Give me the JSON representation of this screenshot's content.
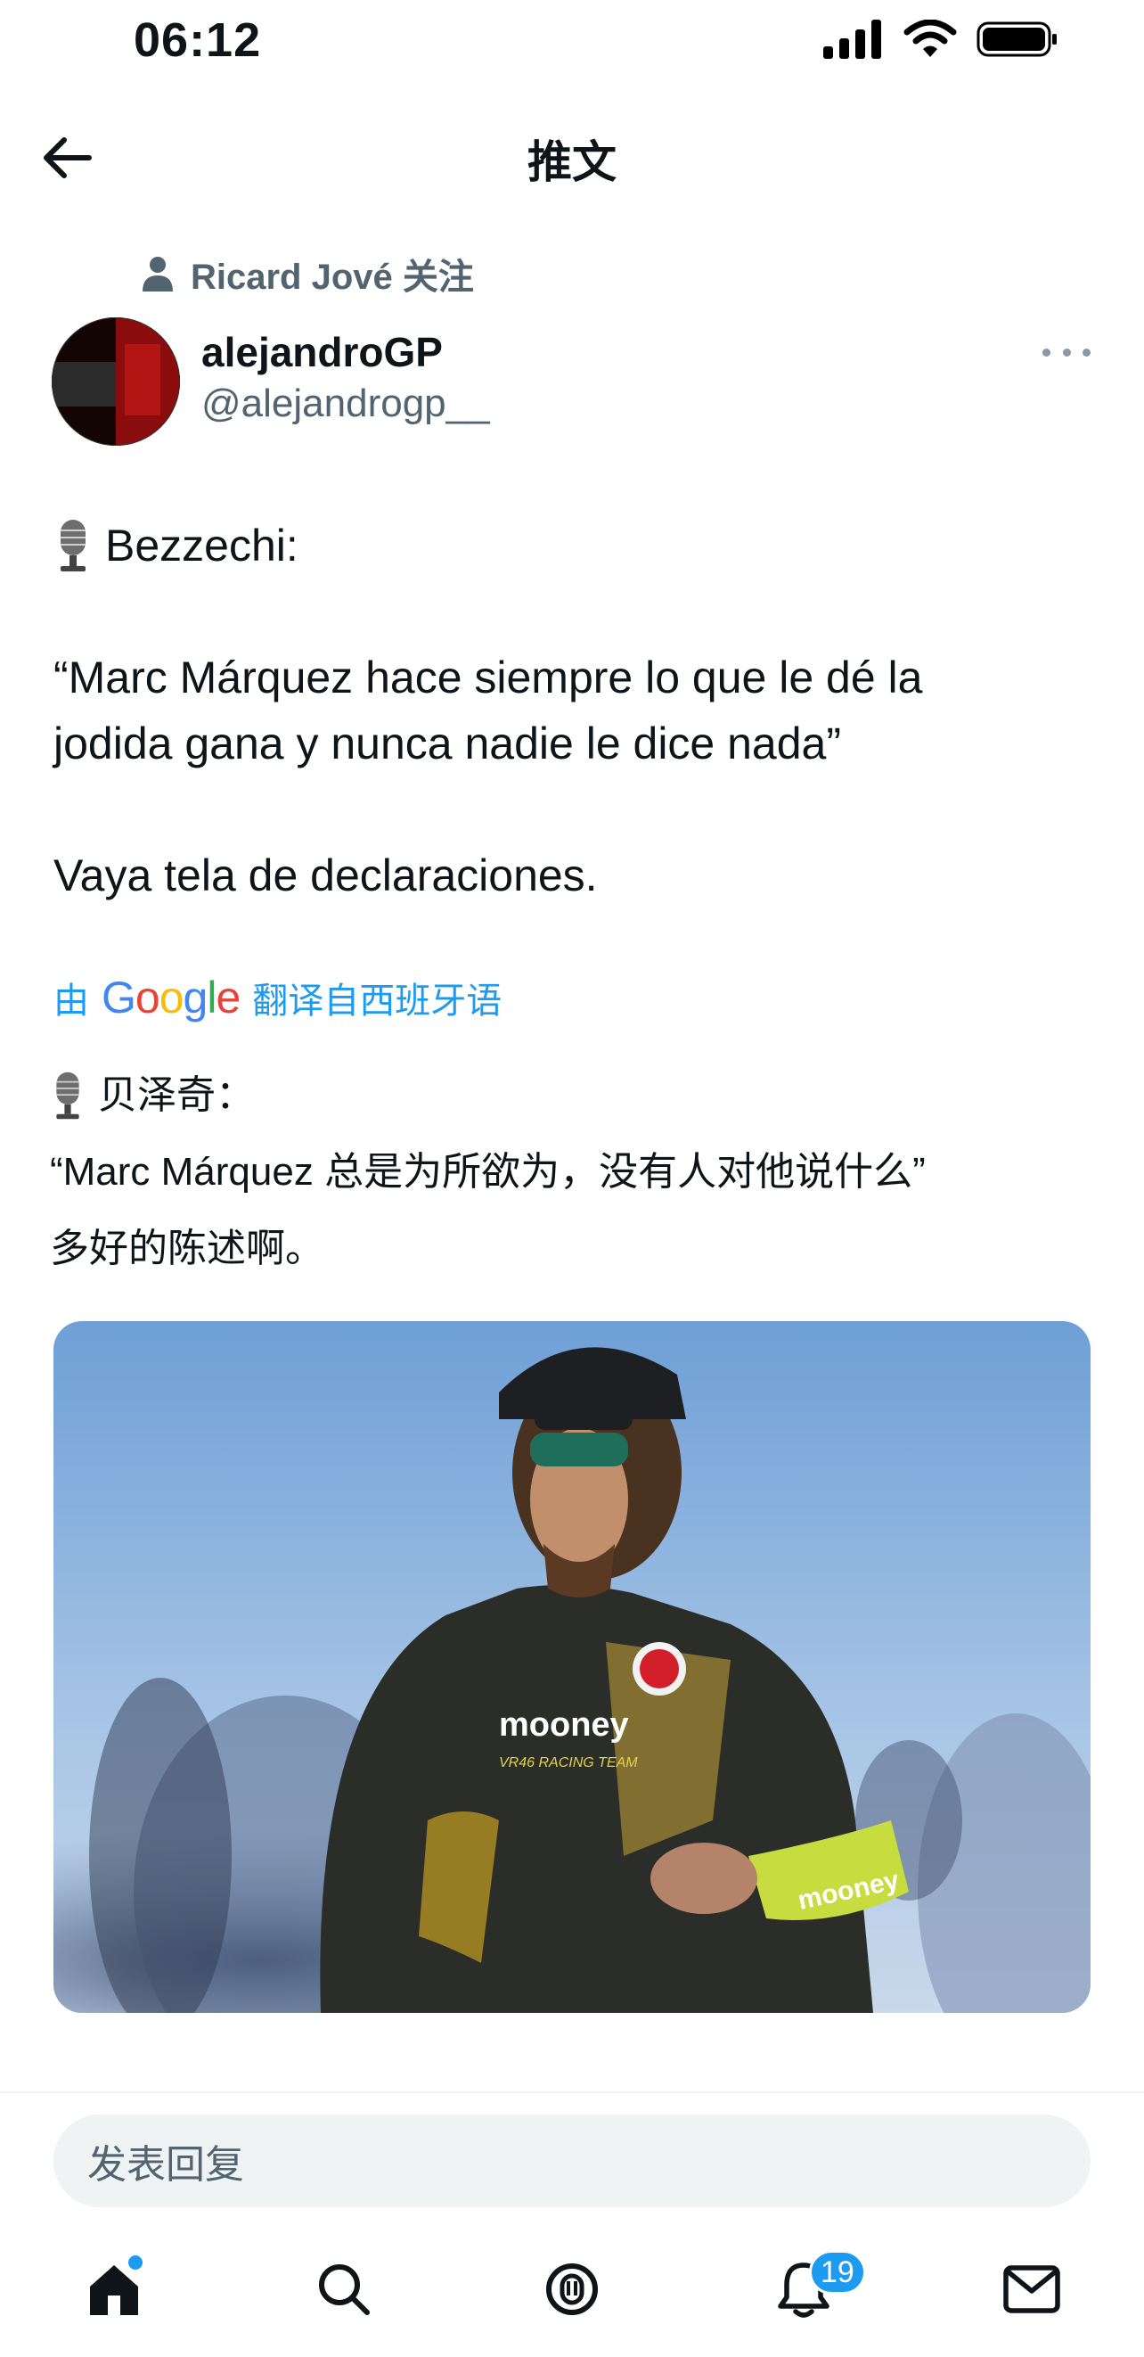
{
  "status_bar": {
    "time": "06:12"
  },
  "header": {
    "title": "推文"
  },
  "social_context": {
    "text": "Ricard Jové 关注"
  },
  "author": {
    "name": "alejandroGP",
    "handle": "@alejandrogp__"
  },
  "tweet": {
    "lines": [
      "Bezzechi:",
      "“Marc Márquez hace siempre lo que le dé la",
      "jodida gana y nunca nadie le dice nada”",
      "Vaya tela de declaraciones."
    ]
  },
  "translation": {
    "prefix": "由",
    "provider": "Google",
    "suffix": "翻译自西班牙语",
    "lines": [
      "贝泽奇：",
      "“Marc Márquez 总是为所欲为，没有人对他说什么”",
      "多好的陈述啊。"
    ]
  },
  "media": {
    "logo_text": "mooney",
    "team_text": "VR46 RACING TEAM"
  },
  "reply": {
    "placeholder": "发表回复"
  },
  "tabbar": {
    "notifications_badge": "19"
  },
  "colors": {
    "accent": "#1d9bf0",
    "secondary_text": "#536471",
    "input_bg": "#eff3f4"
  }
}
